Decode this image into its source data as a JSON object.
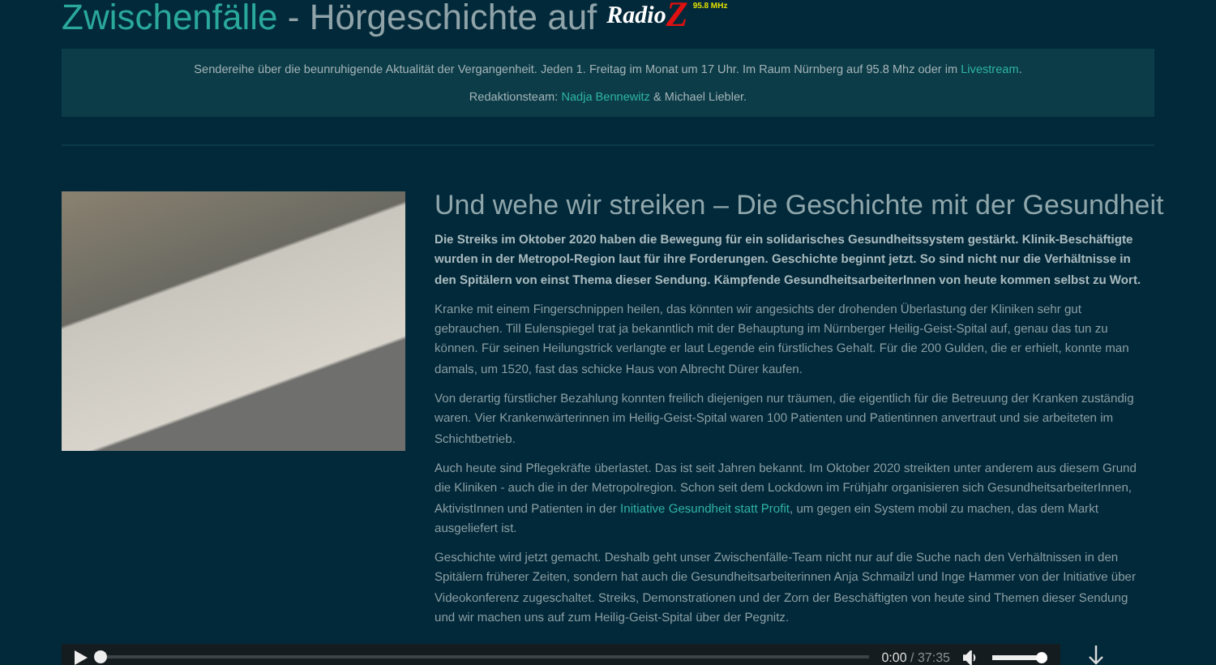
{
  "header": {
    "title_link": "Zwischenfälle",
    "title_rest": "- Hörgeschichte auf",
    "logo": {
      "word": "Radio",
      "letter": "Z",
      "frequency": "95.8 MHz"
    }
  },
  "info_box": {
    "line_1": {
      "text": "Sendereihe über die beunruhigende Aktualität der Vergangenheit. Jeden 1. Freitag im Monat um 17 Uhr. Im Raum Nürnberg auf 95.8 Mhz oder im",
      "link": "Livestream",
      "after": "."
    },
    "line_2": {
      "text": "Redaktionsteam:",
      "link": "Nadja Bennewitz",
      "after": "& Michael Liebler."
    }
  },
  "article": {
    "heading": "Und wehe wir streiken – Die Geschichte mit der Gesundheit",
    "paragraphs": [
      {
        "kind": "lead",
        "text": "Die Streiks im Oktober 2020 haben die Bewegung für ein solidarisches Gesundheitssystem gestärkt. Klinik-Beschäftigte wurden in der Metropol-Region laut für ihre Forderungen. Geschichte beginnt jetzt. So sind nicht nur die Verhältnisse in den Spitälern von einst Thema dieser Sendung. Kämpfende GesundheitsarbeiterInnen von heute kommen selbst zu Wort."
      },
      {
        "kind": "plain",
        "text": "Kranke mit einem Fingerschnippen heilen, das könnten wir angesichts der drohenden Überlastung der Kliniken sehr gut gebrauchen. Till Eulenspiegel trat ja bekanntlich mit der Behauptung im Nürnberger Heilig-Geist-Spital auf, genau das tun zu können. Für seinen Heilungstrick verlangte er laut Legende ein fürstliches Gehalt. Für die 200 Gulden, die er erhielt, konnte man damals, um 1520, fast das schicke Haus von Albrecht Dürer kaufen."
      },
      {
        "kind": "plain",
        "text": "Von derartig fürstlicher Bezahlung konnten freilich diejenigen nur träumen, die eigentlich für die Betreuung der Kranken zuständig waren. Vier Krankenwärterinnen im Heilig-Geist-Spital waren 100 Patienten und Patientinnen anvertraut und sie arbeiteten im Schichtbetrieb."
      },
      {
        "kind": "linked",
        "text": "Auch heute sind Pflegekräfte überlastet. Das ist seit Jahren bekannt. Im Oktober 2020 streikten unter anderem aus diesem Grund die Kliniken - auch die in der Metropolregion. Schon seit dem Lockdown im Frühjahr organisieren sich GesundheitsarbeiterInnen, AktivistInnen und Patienten in der",
        "link": "Initiative Gesundheit statt Profit",
        "after": ", um gegen ein System mobil zu machen, das dem Markt ausgeliefert ist."
      },
      {
        "kind": "plain",
        "text": "Geschichte wird jetzt gemacht. Deshalb geht unser Zwischenfälle-Team nicht nur auf die Suche nach den Verhältnissen in den Spitälern früherer Zeiten, sondern hat auch die Gesundheitsarbeiterinnen Anja Schmailzl und Inge Hammer von der Initiative über Videokonferenz zugeschaltet. Streiks, Demonstrationen und der Zorn der Beschäftigten von heute sind  Themen dieser Sendung und wir machen uns auf zum Heilig-Geist-Spital über der Pegnitz."
      }
    ]
  },
  "player": {
    "current": "0:00",
    "duration": "/ 37:35",
    "progress": {
      "level": 0
    },
    "volume": {
      "level": 0.9
    }
  }
}
